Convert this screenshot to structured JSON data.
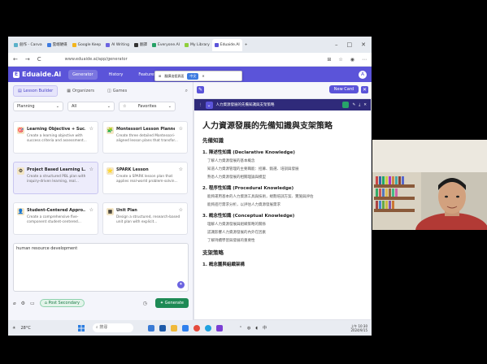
{
  "browser": {
    "tabs": [
      {
        "label": "創作 - Canva",
        "color": "#5bb1c9"
      },
      {
        "label": "雲端硬碟",
        "color": "#3d7be0"
      },
      {
        "label": "Google Keep",
        "color": "#f3b51c"
      },
      {
        "label": "AI Writing",
        "color": "#6b63e0"
      },
      {
        "label": "翻譯",
        "color": "#333333"
      },
      {
        "label": "Everyone.AI",
        "color": "#25a166"
      },
      {
        "label": "My Library",
        "color": "#8fcf3c"
      },
      {
        "label": "Eduaide.AI",
        "color": "#5b54d9",
        "active": true
      }
    ],
    "new_tab": "+",
    "window_controls": [
      "–",
      "□",
      "✕"
    ],
    "url": "www.eduaide.ai/app/generator",
    "back": "←",
    "forward": "→",
    "reload": "C"
  },
  "popup": {
    "text": "翻譯這個頁面",
    "chip": "中文",
    "extra": "✕"
  },
  "app": {
    "logo": "Eduaide.Ai",
    "nav": [
      "Generator",
      "History",
      "Features"
    ],
    "avatar": "A",
    "brand_color": "#5b54d9"
  },
  "left": {
    "tabs": [
      "Lesson Builder",
      "Organizers",
      "Games"
    ],
    "filter_planning": "Planning",
    "filter_all": "All",
    "favorites": "Favorites",
    "cards": [
      {
        "title": "Learning Objective + Suc...",
        "desc": "Create a learning objective with success criteria and assessment...",
        "icon": "🎯"
      },
      {
        "title": "Montessori Lesson Planner",
        "desc": "Create three detailed Montessori-aligned lesson plans that transfor...",
        "icon": "🧩"
      },
      {
        "title": "Project Based Learning L...",
        "desc": "Create a structured PBL plan with inquiry-driven learning, real...",
        "icon": "⚙",
        "selected": true
      },
      {
        "title": "SPARK Lesson",
        "desc": "Create a SPARK lesson plan that applies real-world problem-solvin...",
        "icon": "⭐"
      },
      {
        "title": "Student-Centered Appro...",
        "desc": "Create a comprehensive five-component student-centered...",
        "icon": "👤"
      },
      {
        "title": "Unit Plan",
        "desc": "Design a structured, research-based unit plan with explicit...",
        "icon": "▦"
      }
    ],
    "textarea": "human resource development",
    "pill": "Post Secondary",
    "generate": "Generate"
  },
  "right": {
    "new_card": "New Card",
    "doc_tab_title": "人力資源發展的先備知識與支架策略",
    "title": "人力資源發展的先備知識與支架策略",
    "h_prior": "先備知識",
    "sec1": "1. 陳述性知識 (Declarative Knowledge)",
    "sec1_items": [
      "了解人力資源發展的基本概念",
      "知道人力資源管理的主要職能：招募、甄選、培訓與發展",
      "熟悉人力資源發展的相關理論與模型"
    ],
    "sec2": "2. 程序性知識 (Procedural Knowledge)",
    "sec2_items": [
      "能夠運用基本的人力資源工具與技術，規劃培訓方案、實施與評估",
      "能夠進行需求分析，以評估人力資源發展需求"
    ],
    "sec3": "3. 概念性知識 (Conceptual Knowledge)",
    "sec3_items": [
      "理解人力資源發展與組織策略的關係",
      "認識影響人力資源發展的內外在因素",
      "了解持續學習與發展的重要性"
    ],
    "h_support": "支架策略",
    "sub1": "1. 概念圖與組織架構"
  },
  "taskbar": {
    "weather": "28°C",
    "search": "搜尋",
    "clock_time": "上午 10:30",
    "clock_date": "2024/9/15"
  }
}
